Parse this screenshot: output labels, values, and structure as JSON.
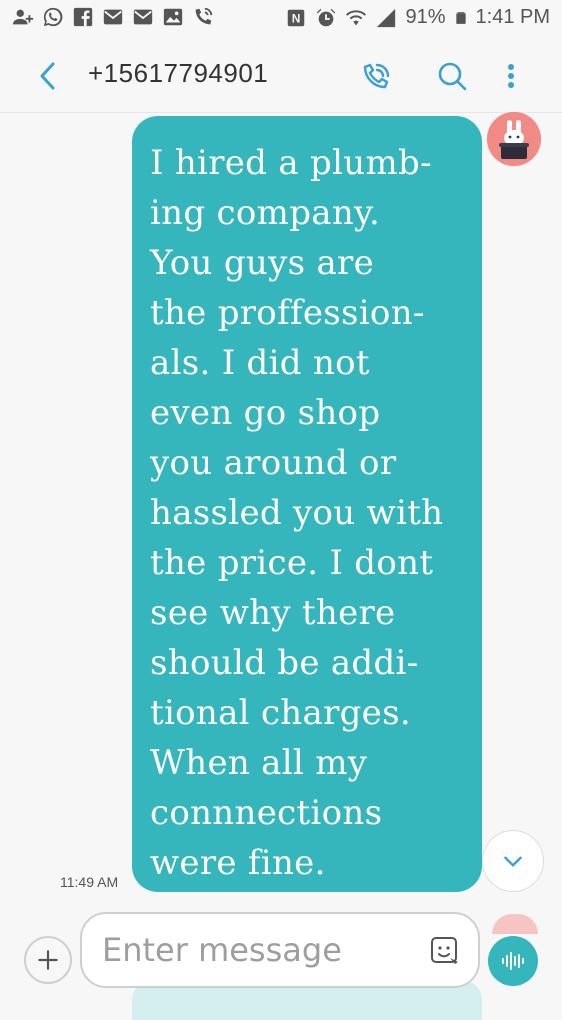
{
  "status_bar": {
    "battery": "91%",
    "time": "1:41 PM",
    "left_icons": [
      "person-add-icon",
      "whatsapp-icon",
      "facebook-icon",
      "mail-icon",
      "email-icon",
      "gallery-icon",
      "wifi-call-icon"
    ],
    "right_icons": [
      "nfc-icon",
      "alarm-icon",
      "wifi-icon",
      "signal-icon",
      "battery-icon"
    ]
  },
  "header": {
    "contact": "+15617794901",
    "icons": [
      "back-icon",
      "wifi-call-icon",
      "search-icon",
      "more-vertical-icon"
    ]
  },
  "message": {
    "lines": [
      "I hired  a plumb-",
      "ing company.",
      "You guys are",
      "the proffession-",
      "als. I did not",
      "even go shop",
      "you around or",
      "hassled you with",
      "the price. I dont",
      "see why there",
      "should be addi-",
      "tional charges.",
      "When all my",
      "connnections",
      "were fine."
    ],
    "time": "11:49 AM"
  },
  "composer": {
    "placeholder": "Enter message",
    "icons": [
      "add-icon",
      "sticker-icon",
      "voice-icon"
    ]
  },
  "colors": {
    "bubble": "#35b5bc",
    "accent": "#3a9fd6",
    "background": "#f7f7f7"
  }
}
